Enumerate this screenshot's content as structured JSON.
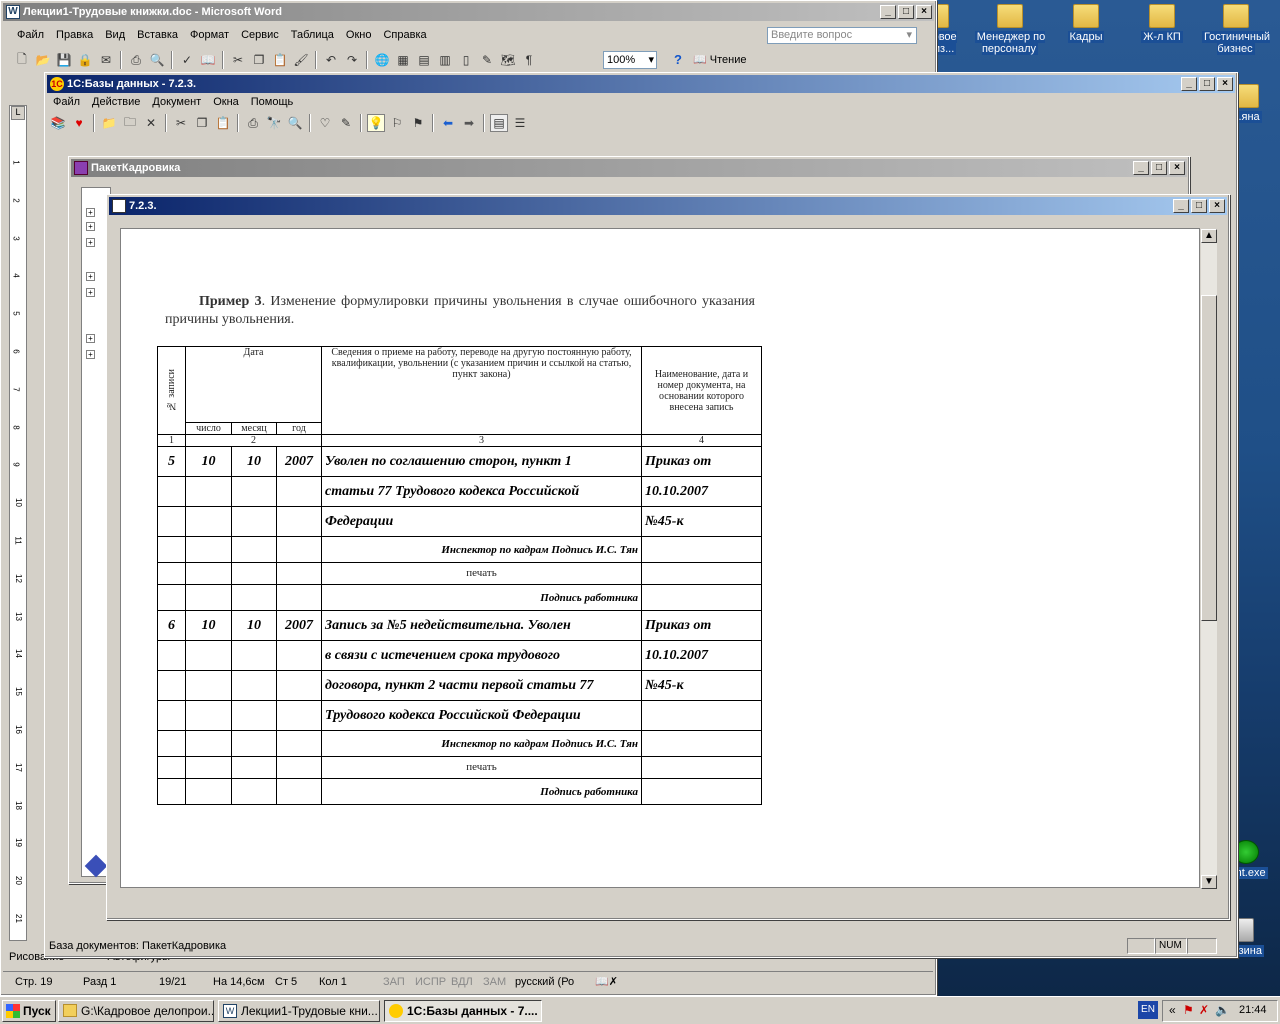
{
  "desktop": {
    "icons": [
      {
        "label": "...ровое\nпроиз...",
        "kind": "folder"
      },
      {
        "label": "Менеджер по персоналу",
        "kind": "folder"
      },
      {
        "label": "Кадры",
        "kind": "folder"
      },
      {
        "label": "Ж-л КП",
        "kind": "folder"
      },
      {
        "label": "Гостиничный бизнес",
        "kind": "folder"
      },
      {
        "label": "...яна",
        "kind": "folder"
      },
      {
        "label": "...nt.exe",
        "kind": "app"
      },
      {
        "label": "Корзина",
        "kind": "recycle"
      }
    ]
  },
  "word": {
    "title": "Лекции1-Трудовые книжки.doc - Microsoft Word",
    "menu": [
      "Файл",
      "Правка",
      "Вид",
      "Вставка",
      "Формат",
      "Сервис",
      "Таблица",
      "Окно",
      "Справка"
    ],
    "ask_placeholder": "Введите вопрос",
    "zoom": "100%",
    "reading": "Чтение",
    "drawing": "Рисование",
    "autoshapes": "Автофигуры",
    "status": {
      "page": "Стр. 19",
      "section": "Разд 1",
      "pages": "19/21",
      "at": "На 14,6см",
      "line": "Ст 5",
      "col": "Кол 1",
      "rec": "ЗАП",
      "trk": "ИСПР",
      "ext": "ВДЛ",
      "ovr": "ЗАМ",
      "lang": "русский (Ро"
    },
    "ruler_marks": [
      "1",
      "2",
      "3",
      "4",
      "5",
      "6",
      "7",
      "8",
      "9",
      "10",
      "11",
      "12",
      "13",
      "14",
      "15",
      "16",
      "17",
      "18",
      "19",
      "20",
      "21"
    ]
  },
  "onec": {
    "title": "1С:Базы данных - 7.2.3.",
    "menu": [
      "Файл",
      "Действие",
      "Документ",
      "Окна",
      "Помощь"
    ],
    "status_text": "База документов: ПакетКадровика",
    "num": "NUM"
  },
  "paket": {
    "title": "ПакетКадровика"
  },
  "doc": {
    "title": "7.2.3.",
    "example_bold": "Пример 3",
    "example_text": ". Изменение формулировки причины увольнения в случае ошибочного указания причины увольнения.",
    "table": {
      "h_no": "№ записи",
      "h_date": "Дата",
      "h_info": "Сведения о приеме на работу, переводе на другую постоянную работу, квалификации, увольнении (с указанием причин и ссылкой на статью, пункт закона)",
      "h_doc": "Наименование, дата и номер документа, на основании которого внесена запись",
      "h_day": "число",
      "h_month": "месяц",
      "h_year": "год",
      "col_nums": [
        "1",
        "2",
        "3",
        "4"
      ],
      "rows": [
        {
          "no": "5",
          "d": "10",
          "m": "10",
          "y": "2007",
          "text": "Уволен по соглашению сторон, пункт 1",
          "doc": "Приказ от"
        },
        {
          "no": "",
          "d": "",
          "m": "",
          "y": "",
          "text": "статьи 77 Трудового кодекса Российской",
          "doc": "10.10.2007"
        },
        {
          "no": "",
          "d": "",
          "m": "",
          "y": "",
          "text": "Федерации",
          "doc": "№45-к"
        },
        {
          "no": "",
          "d": "",
          "m": "",
          "y": "",
          "sign": "Инспектор по кадрам Подпись И.С. Тян",
          "doc": ""
        },
        {
          "no": "",
          "d": "",
          "m": "",
          "y": "",
          "stamp": "печать",
          "doc": ""
        },
        {
          "no": "",
          "d": "",
          "m": "",
          "y": "",
          "sign": "Подпись работника",
          "doc": ""
        },
        {
          "no": "6",
          "d": "10",
          "m": "10",
          "y": "2007",
          "text": "Запись за №5 недействительна. Уволен",
          "doc": "Приказ от"
        },
        {
          "no": "",
          "d": "",
          "m": "",
          "y": "",
          "text": "в связи с истечением срока трудового",
          "doc": "10.10.2007"
        },
        {
          "no": "",
          "d": "",
          "m": "",
          "y": "",
          "text": "договора, пункт 2 части первой статьи 77",
          "doc": "№45-к"
        },
        {
          "no": "",
          "d": "",
          "m": "",
          "y": "",
          "text": "Трудового кодекса Российской Федерации",
          "doc": ""
        },
        {
          "no": "",
          "d": "",
          "m": "",
          "y": "",
          "sign": "Инспектор по кадрам Подпись И.С. Тян",
          "doc": ""
        },
        {
          "no": "",
          "d": "",
          "m": "",
          "y": "",
          "stamp": "печать",
          "doc": ""
        },
        {
          "no": "",
          "d": "",
          "m": "",
          "y": "",
          "sign": "Подпись работника",
          "doc": ""
        }
      ]
    }
  },
  "taskbar": {
    "start": "Пуск",
    "tasks": [
      "G:\\Кадровое делопрои...",
      "Лекции1-Трудовые кни...",
      "1С:Базы данных - 7...."
    ],
    "lang": "EN",
    "time": "21:44"
  }
}
